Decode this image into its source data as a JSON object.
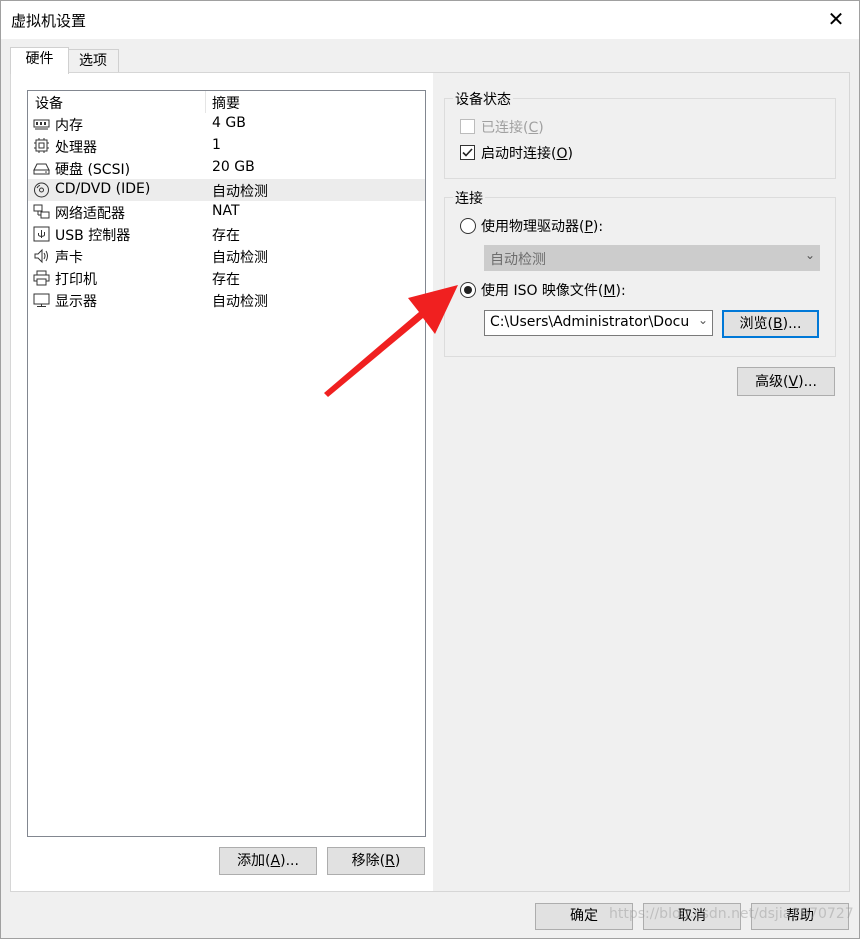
{
  "window": {
    "title": "虚拟机设置",
    "close_glyph": "✕"
  },
  "tabs": [
    {
      "label": "硬件"
    },
    {
      "label": "选项"
    }
  ],
  "device_list": {
    "col_device": "设备",
    "col_summary": "摘要",
    "rows": [
      {
        "name": "内存",
        "value": "4 GB",
        "icon": "memory-icon"
      },
      {
        "name": "处理器",
        "value": "1",
        "icon": "processor-icon"
      },
      {
        "name": "硬盘 (SCSI)",
        "value": "20 GB",
        "icon": "harddisk-icon"
      },
      {
        "name": "CD/DVD (IDE)",
        "value": "自动检测",
        "icon": "cd-dvd-icon",
        "selected": true
      },
      {
        "name": "网络适配器",
        "value": "NAT",
        "icon": "network-adapter-icon"
      },
      {
        "name": "USB 控制器",
        "value": "存在",
        "icon": "usb-icon"
      },
      {
        "name": "声卡",
        "value": "自动检测",
        "icon": "speaker-icon"
      },
      {
        "name": "打印机",
        "value": "存在",
        "icon": "printer-icon"
      },
      {
        "name": "显示器",
        "value": "自动检测",
        "icon": "monitor-icon"
      }
    ]
  },
  "left_buttons": {
    "add": {
      "text": "添加(",
      "key": "A",
      "suffix": ")..."
    },
    "remove": {
      "text": "移除(",
      "key": "R",
      "suffix": ")"
    }
  },
  "device_status": {
    "legend": "设备状态",
    "connected": {
      "text": "已连接(",
      "key": "C",
      "suffix": ")",
      "checked": false,
      "disabled": true
    },
    "connect_at_power_on": {
      "text": "启动时连接(",
      "key": "O",
      "suffix": ")",
      "checked": true
    }
  },
  "connection": {
    "legend": "连接",
    "physical": {
      "text": "使用物理驱动器(",
      "key": "P",
      "suffix": "):",
      "selected": false
    },
    "physical_select": "自动检测",
    "iso": {
      "text": "使用 ISO 映像文件(",
      "key": "M",
      "suffix": "):",
      "selected": true
    },
    "iso_path": "C:\\Users\\Administrator\\Docum",
    "browse": {
      "text": "浏览(",
      "key": "B",
      "suffix": ")..."
    }
  },
  "advanced": {
    "text": "高级(",
    "key": "V",
    "suffix": ")..."
  },
  "footer": {
    "ok": "确定",
    "cancel": "取消",
    "help": "帮助"
  },
  "watermark": "https://blog.csdn.net/dsjia2970727",
  "colors": {
    "arrow": "#f02020",
    "focus": "#0078d7"
  }
}
